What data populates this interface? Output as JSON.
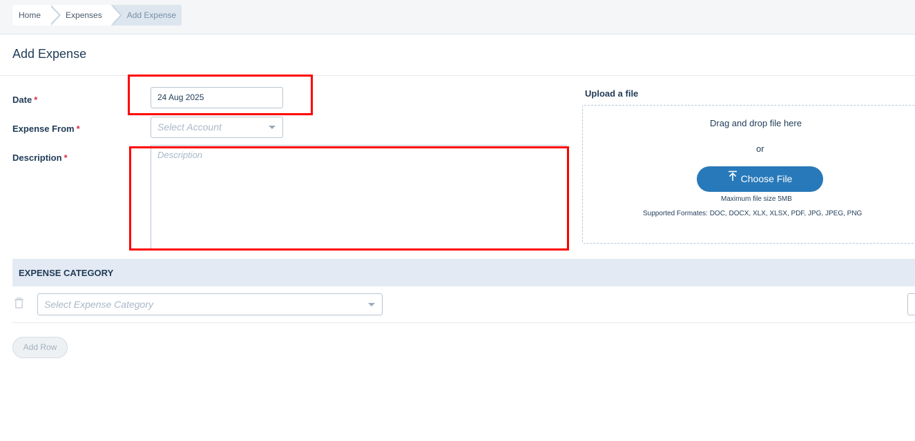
{
  "breadcrumb": {
    "home": "Home",
    "expenses": "Expenses",
    "current": "Add Expense"
  },
  "page": {
    "title": "Add Expense"
  },
  "form": {
    "date": {
      "label": "Date",
      "required_mark": "*",
      "value": "24 Aug 2025"
    },
    "expense_from": {
      "label": "Expense From",
      "required_mark": "*",
      "placeholder": "Select Account"
    },
    "description": {
      "label": "Description",
      "required_mark": "*",
      "placeholder": "Description"
    }
  },
  "upload": {
    "title": "Upload a file",
    "drag_text": "Drag and drop file here",
    "or_text": "or",
    "button_label": "Choose File",
    "button_icon": "upload-icon",
    "max_size": "Maximum file size 5MB",
    "formats": "Supported Formates: DOC, DOCX, XLX, XLSX, PDF, JPG, JPEG, PNG"
  },
  "expense_category": {
    "header": "EXPENSE CATEGORY",
    "row_placeholder": "Select Expense Category",
    "delete_icon": "trash-icon",
    "add_row_label": "Add Row"
  },
  "colors": {
    "accent": "#2879b9",
    "heading": "#1f3b57",
    "required": "#d9304b",
    "highlight": "#ff0000",
    "category_header_bg": "#e4eaf3"
  }
}
